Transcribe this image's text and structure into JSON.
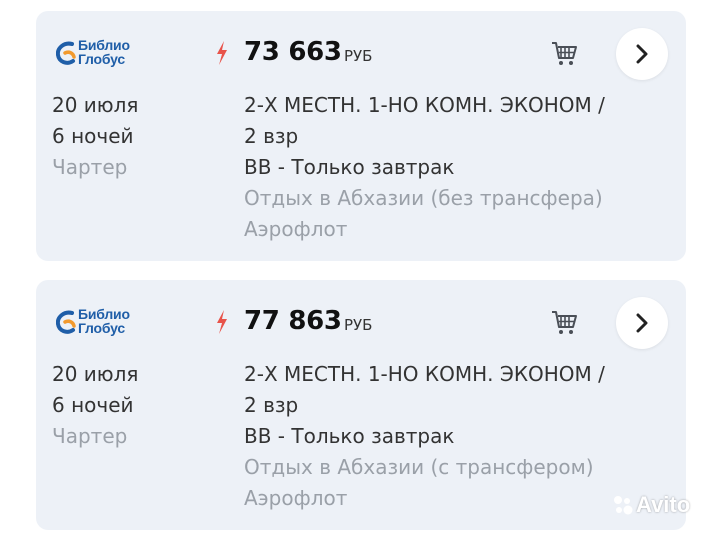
{
  "colors": {
    "card_bg": "#edf1f7",
    "bolt": "#e8534a",
    "logo_blue": "#1f5ea8",
    "logo_orange": "#f29a2e",
    "muted_text": "#9aa0a8"
  },
  "offers": [
    {
      "operator_line1": "Библио",
      "operator_line2": "Глобус",
      "price": "73 663",
      "currency": "РУБ",
      "date": "20 июля",
      "nights": "6 ночей",
      "flight_type": "Чартер",
      "room_line1": "2-Х МЕСТН. 1-НО КОМН. ЭКОНОМ /",
      "room_line2": "2 взр",
      "meal": "BB - Только завтрак",
      "tour_name": "Отдых в Абхазии (без трансфера)",
      "airline": "Аэрофлот",
      "icons": {
        "bolt": "lightning-icon",
        "cart": "cart-icon",
        "next": "chevron-right-icon"
      }
    },
    {
      "operator_line1": "Библио",
      "operator_line2": "Глобус",
      "price": "77 863",
      "currency": "РУБ",
      "date": "20 июля",
      "nights": "6 ночей",
      "flight_type": "Чартер",
      "room_line1": "2-Х МЕСТН. 1-НО КОМН. ЭКОНОМ /",
      "room_line2": "2 взр",
      "meal": "BB - Только завтрак",
      "tour_name": "Отдых в Абхазии (с трансфером)",
      "airline": "Аэрофлот",
      "icons": {
        "bolt": "lightning-icon",
        "cart": "cart-icon",
        "next": "chevron-right-icon"
      }
    }
  ],
  "watermark": "Avito"
}
